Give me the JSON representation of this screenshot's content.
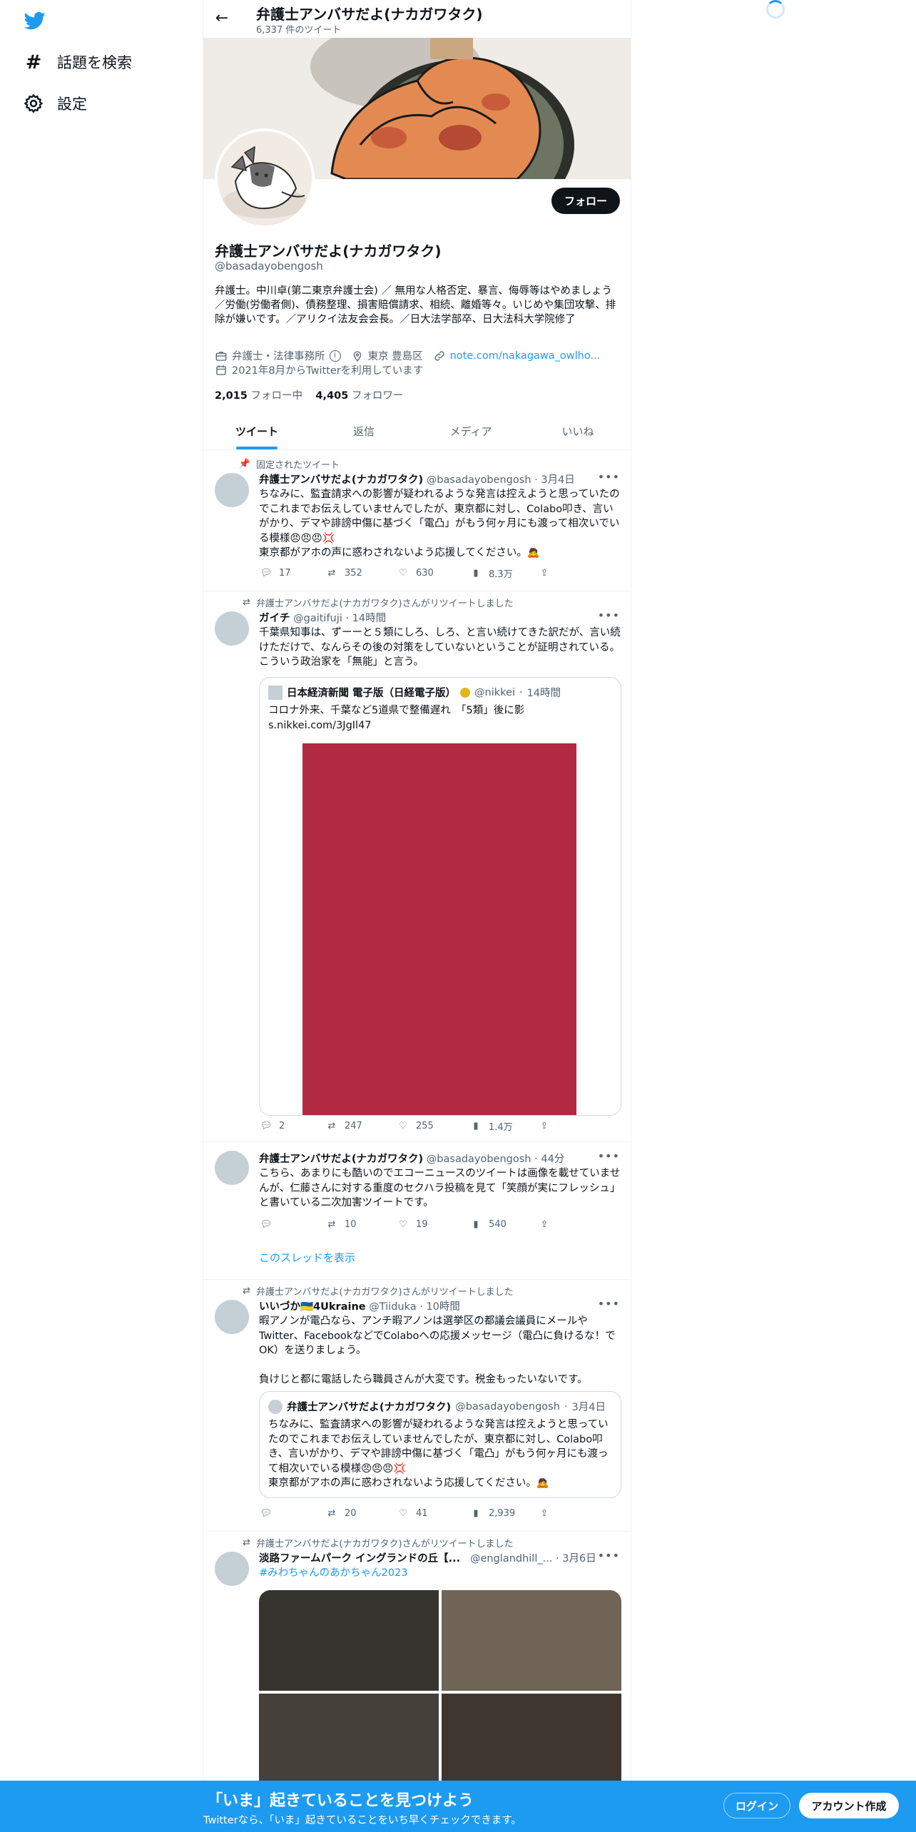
{
  "colors": {
    "accent": "#1d9bf0",
    "text": "#0f1419",
    "muted": "#536471",
    "quote_image": "#b22a42"
  },
  "nav": {
    "logo_icon": "twitter-bird-icon",
    "items": [
      {
        "icon": "hashtag-icon",
        "label": "話題を検索"
      },
      {
        "icon": "gear-icon",
        "label": "設定"
      }
    ]
  },
  "header": {
    "name": "弁護士アンバサだよ(ナカガワタク)",
    "tweet_count": "6,337 件のツイート"
  },
  "profile": {
    "name": "弁護士アンバサだよ(ナカガワタク)",
    "handle": "@basadayobengosh",
    "follow_label": "フォロー",
    "bio": "弁護士。中川卓(第二東京弁護士会) ／ 無用な人格否定、暴言、侮辱等はやめましょう／労働(労働者側)、債務整理、損害賠償請求、相続、離婚等々。いじめや集団攻撃、排除が嫌いです。／アリクイ法友会会長。／日大法学部卒、日大法科大学院修了",
    "category": "弁護士・法律事務所",
    "location": "東京 豊島区",
    "link": "note.com/nakagawa_owlho...",
    "joined": "2021年8月からTwitterを利用しています",
    "following_count": "2,015",
    "following_label": "フォロー中",
    "followers_count": "4,405",
    "followers_label": "フォロワー"
  },
  "tabs": [
    {
      "label": "ツイート"
    },
    {
      "label": "返信"
    },
    {
      "label": "メディア"
    },
    {
      "label": "いいね"
    }
  ],
  "tweets": [
    {
      "context": "固定されたツイート",
      "name": "弁護士アンバサだよ(ナカガワタク)",
      "handle": "@basadayobengosh",
      "time": "3月4日",
      "text": "ちなみに、監査請求への影響が疑われるような発言は控えようと思っていたのでこれまでお伝えしていませんでしたが、東京都に対し、Colabo叩き、言いがかり、デマや誹謗中傷に基づく「電凸」がもう何ヶ月にも渡って相次いでいる模様😠😠😠💢\n東京都がアホの声に惑わされないよう応援してください。🙇",
      "replies": "17",
      "retweets": "352",
      "likes": "630",
      "views": "8.3万"
    },
    {
      "context": "弁護士アンバサだよ(ナカガワタク)さんがリツイートしました",
      "name": "ガイチ",
      "handle": "@gaitifuji",
      "time": "14時間",
      "text": "千葉県知事は、ずーーと５類にしろ、しろ、と言い続けてきた訳だが、言い続けただけで、なんらその後の対策をしていないということが証明されている。こういう政治家を「無能」と言う。",
      "quote": {
        "name": "日本経済新聞 電子版（日経電子版）",
        "handle": "@nikkei",
        "time": "14時間",
        "text": "コロナ外来、千葉など5道県で整備遅れ　「5類」後に影\ns.nikkei.com/3JgIl47"
      },
      "replies": "2",
      "retweets": "247",
      "likes": "255",
      "views": "1.4万"
    },
    {
      "name": "弁護士アンバサだよ(ナカガワタク)",
      "handle": "@basadayobengosh",
      "time": "44分",
      "text": "こちら、あまりにも酷いのでエコーニュースのツイートは画像を載せていませんが、仁藤さんに対する重度のセクハラ投稿を見て「笑顔が実にフレッシュ」と書いている二次加害ツイートです。",
      "replies": "",
      "retweets": "10",
      "likes": "19",
      "views": "540",
      "thread_link": "このスレッドを表示"
    },
    {
      "context": "弁護士アンバサだよ(ナカガワタク)さんがリツイートしました",
      "name": "いいづか🇺🇦4Ukraine",
      "handle": "@Tiiduka",
      "time": "10時間",
      "text": "暇アノンが電凸なら、アンチ暇アノンは選挙区の都議会議員にメールやTwitter、FacebookなどでColaboへの応援メッセージ（電凸に負けるな！でOK）を送りましょう。\n\n負けじと都に電話したら職員さんが大変です。税金もったいないです。",
      "quote": {
        "name": "弁護士アンバサだよ(ナカガワタク)",
        "handle": "@basadayobengosh",
        "time": "3月4日",
        "text": "ちなみに、監査請求への影響が疑われるような発言は控えようと思っていたのでこれまでお伝えしていませんでしたが、東京都に対し、Colabo叩き、言いがかり、デマや誹謗中傷に基づく「電凸」がもう何ヶ月にも渡って相次いでいる模様😠😠😠💢\n東京都がアホの声に惑わされないよう応援してください。🙇"
      },
      "replies": "",
      "retweets": "20",
      "likes": "41",
      "views": "2,939"
    },
    {
      "context": "弁護士アンバサだよ(ナカガワタク)さんがリツイートしました",
      "name": "淡路ファームパーク イングランドの丘【...",
      "handle": "@englandhill_...",
      "time": "3月6日",
      "hashtag": "#みわちゃんのあかちゃん2023"
    }
  ],
  "bottom_bar": {
    "title": "「いま」起きていることを見つけよう",
    "subtitle": "Twitterなら、「いま」起きていることをいち早くチェックできます。",
    "login": "ログイン",
    "signup": "アカウント作成"
  }
}
